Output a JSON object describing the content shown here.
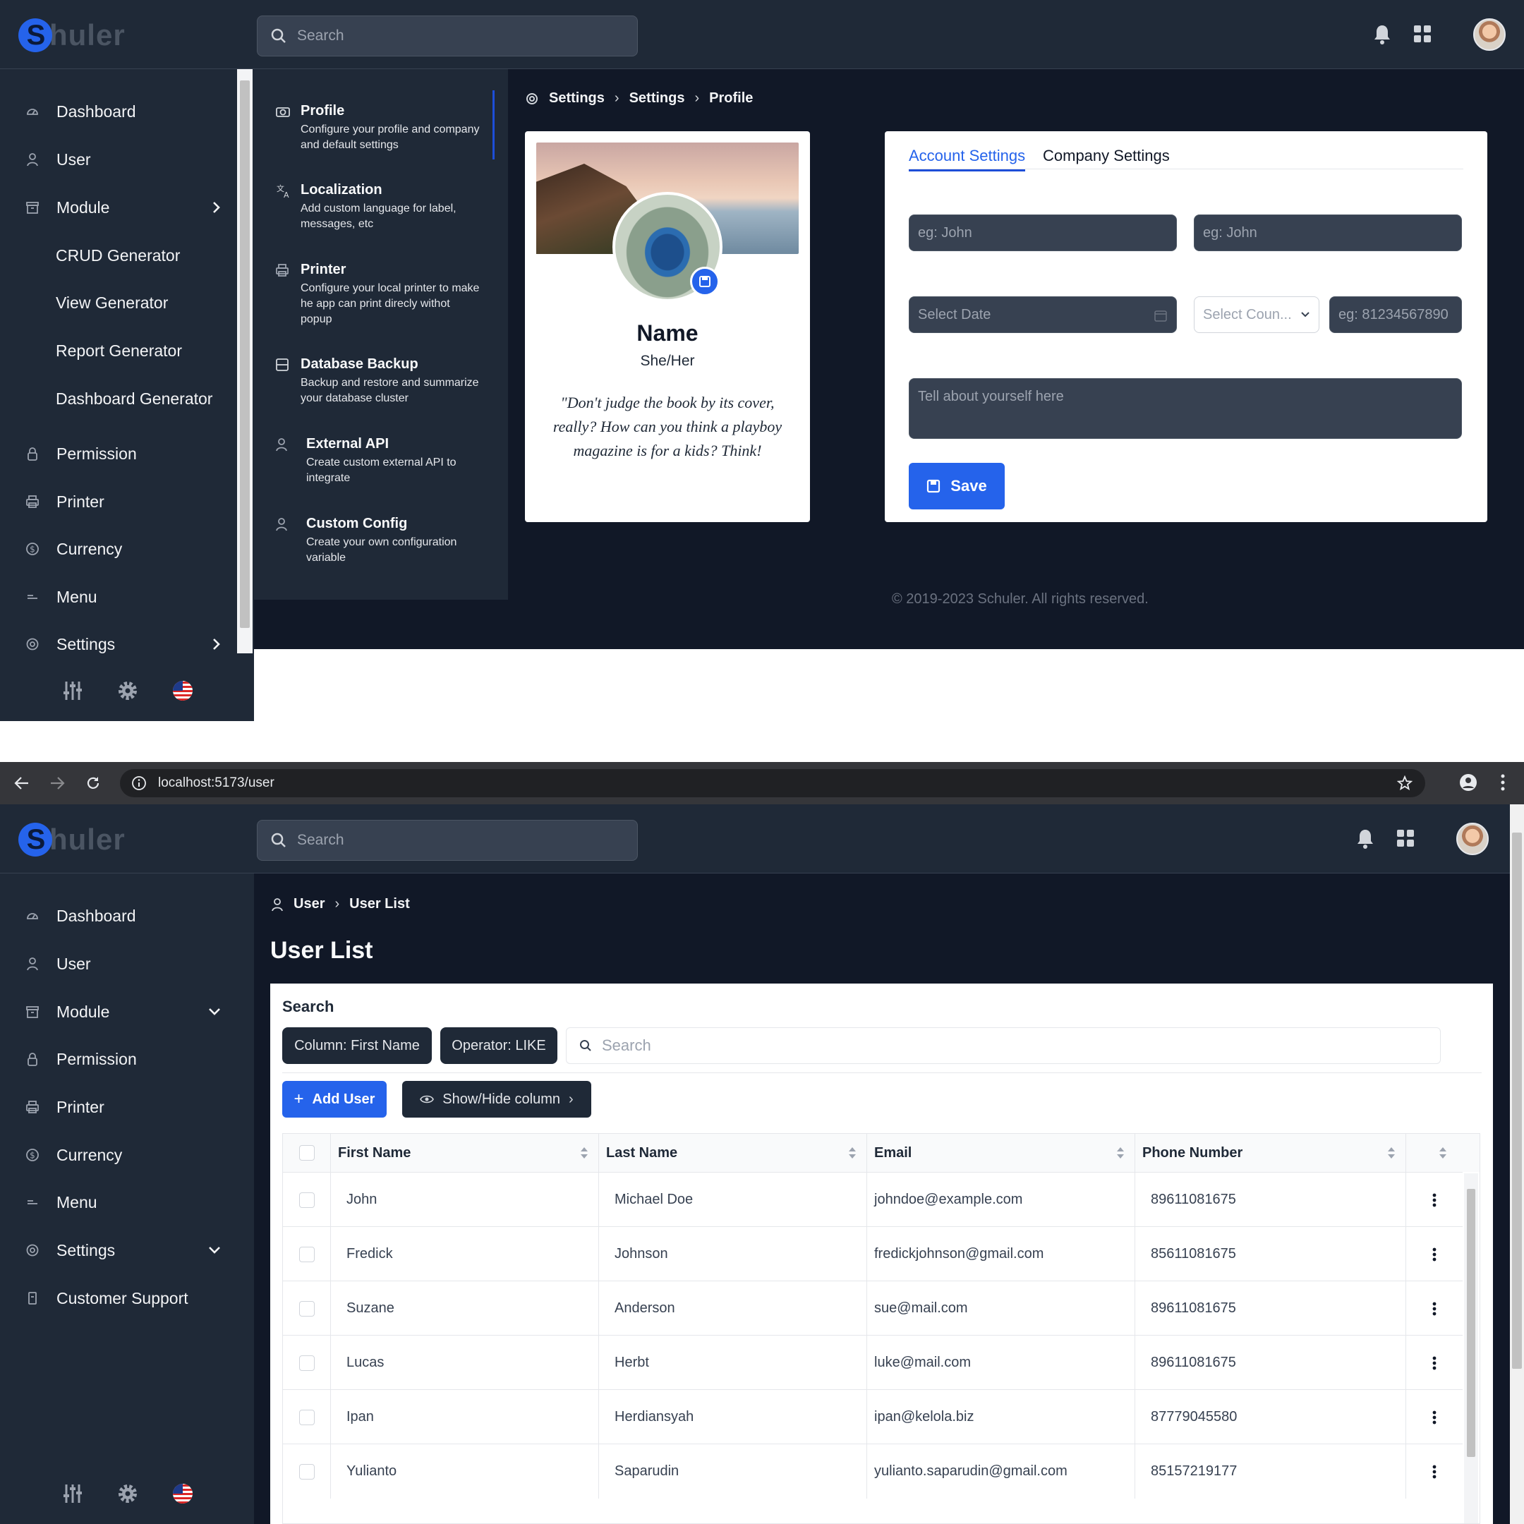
{
  "top": {
    "logo_text": "huler",
    "search_placeholder": "Search",
    "sidebar": [
      {
        "label": "Dashboard",
        "icon": "gauge-icon"
      },
      {
        "label": "User",
        "icon": "user-icon"
      },
      {
        "label": "Module",
        "icon": "archive-icon",
        "chevron": "right"
      },
      {
        "label": "CRUD Generator"
      },
      {
        "label": "View Generator"
      },
      {
        "label": "Report Generator"
      },
      {
        "label": "Dashboard Generator"
      },
      {
        "label": "Permission",
        "icon": "lock-icon"
      },
      {
        "label": "Printer",
        "icon": "printer-icon"
      },
      {
        "label": "Currency",
        "icon": "currency-icon"
      },
      {
        "label": "Menu",
        "icon": "menu-icon"
      },
      {
        "label": "Settings",
        "icon": "gear-icon",
        "chevron": "right"
      }
    ],
    "settings_menu": [
      {
        "title": "Profile",
        "desc": "Configure your profile and company and default settings",
        "icon": "camera-icon"
      },
      {
        "title": "Localization",
        "desc": "Add custom language for label, messages, etc",
        "icon": "translate-icon"
      },
      {
        "title": "Printer",
        "desc": "Configure your local printer to make he app can print direcly withot popup",
        "icon": "printer-icon"
      },
      {
        "title": "Database Backup",
        "desc": "Backup and restore and summarize your database cluster",
        "icon": "database-icon"
      },
      {
        "title": "External API",
        "desc": "Create custom external API to integrate",
        "icon": "user-icon"
      },
      {
        "title": "Custom Config",
        "desc": "Create your own configuration variable",
        "icon": "user-icon"
      }
    ],
    "breadcrumb": [
      "Settings",
      "Settings",
      "Profile"
    ],
    "profile": {
      "name": "Name",
      "pronoun": "She/Her",
      "quote": "\"Don't judge the book by its cover, really? How can you think a playboy magazine is for a kids? Think!"
    },
    "tabs": [
      "Account Settings",
      "Company Settings"
    ],
    "form": {
      "first_name_ph": "eg: John",
      "last_name_ph": "eg: John",
      "date_ph": "Select Date",
      "country_ph": "Select Coun...",
      "phone_ph": "eg: 81234567890",
      "bio_ph": "Tell about yourself here",
      "save_label": "Save"
    },
    "footer": "© 2019-2023 Schuler. All rights reserved."
  },
  "browser": {
    "url": "localhost:5173/user"
  },
  "bottom": {
    "logo_text": "huler",
    "search_placeholder": "Search",
    "sidebar": [
      {
        "label": "Dashboard",
        "icon": "gauge-icon"
      },
      {
        "label": "User",
        "icon": "user-icon"
      },
      {
        "label": "Module",
        "icon": "archive-icon",
        "chevron": "down"
      },
      {
        "label": "Permission",
        "icon": "lock-icon"
      },
      {
        "label": "Printer",
        "icon": "printer-icon"
      },
      {
        "label": "Currency",
        "icon": "currency-icon"
      },
      {
        "label": "Menu",
        "icon": "menu-icon"
      },
      {
        "label": "Settings",
        "icon": "gear-icon",
        "chevron": "down"
      },
      {
        "label": "Customer Support",
        "icon": "support-icon"
      }
    ],
    "breadcrumb": [
      "User",
      "User List"
    ],
    "page_title": "User List",
    "search_label": "Search",
    "column_filter": "Column: First Name",
    "operator_filter": "Operator: LIKE",
    "table_search_ph": "Search",
    "add_user_label": "Add User",
    "show_hide_label": "Show/Hide column",
    "columns": [
      "First Name",
      "Last Name",
      "Email",
      "Phone Number"
    ],
    "rows": [
      {
        "first": "John",
        "last": "Michael Doe",
        "email": "johndoe@example.com",
        "phone": "89611081675"
      },
      {
        "first": "Fredick",
        "last": "Johnson",
        "email": "fredickjohnson@gmail.com",
        "phone": "85611081675"
      },
      {
        "first": "Suzane",
        "last": "Anderson",
        "email": "sue@mail.com",
        "phone": "89611081675"
      },
      {
        "first": "Lucas",
        "last": "Herbt",
        "email": "luke@mail.com",
        "phone": "89611081675"
      },
      {
        "first": "Ipan",
        "last": "Herdiansyah",
        "email": "ipan@kelola.biz",
        "phone": "87779045580"
      },
      {
        "first": "Yulianto",
        "last": "Saparudin",
        "email": "yulianto.saparudin@gmail.com",
        "phone": "85157219177"
      }
    ]
  },
  "colors": {
    "accent": "#2563eb",
    "bg_dark": "#111827",
    "panel": "#1f2937"
  }
}
